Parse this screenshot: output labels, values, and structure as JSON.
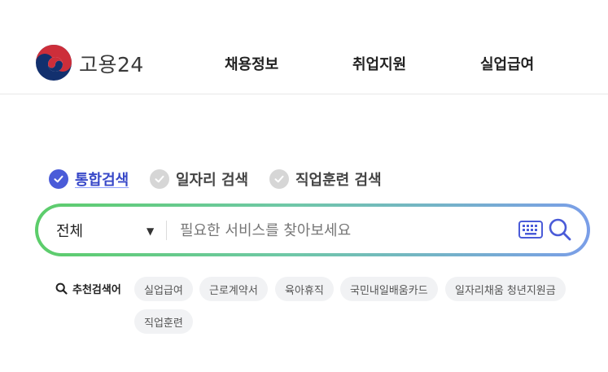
{
  "logo": {
    "text": "고용24"
  },
  "nav": {
    "items": [
      {
        "label": "채용정보"
      },
      {
        "label": "취업지원"
      },
      {
        "label": "실업급여"
      }
    ]
  },
  "search_tabs": [
    {
      "label": "통합검색",
      "active": true
    },
    {
      "label": "일자리 검색",
      "active": false
    },
    {
      "label": "직업훈련 검색",
      "active": false
    }
  ],
  "search": {
    "scope": "전체",
    "placeholder": "필요한 서비스를 찾아보세요"
  },
  "recommended": {
    "title": "추천검색어",
    "chips": [
      "실업급여",
      "근로계약서",
      "육아휴직",
      "국민내일배움카드",
      "일자리채움 청년지원금",
      "직업훈련"
    ]
  },
  "colors": {
    "accent": "#3848c8",
    "gradient_start": "#5ccd6a",
    "gradient_end": "#7a9ee8",
    "chip_bg": "#f1f2f4"
  }
}
